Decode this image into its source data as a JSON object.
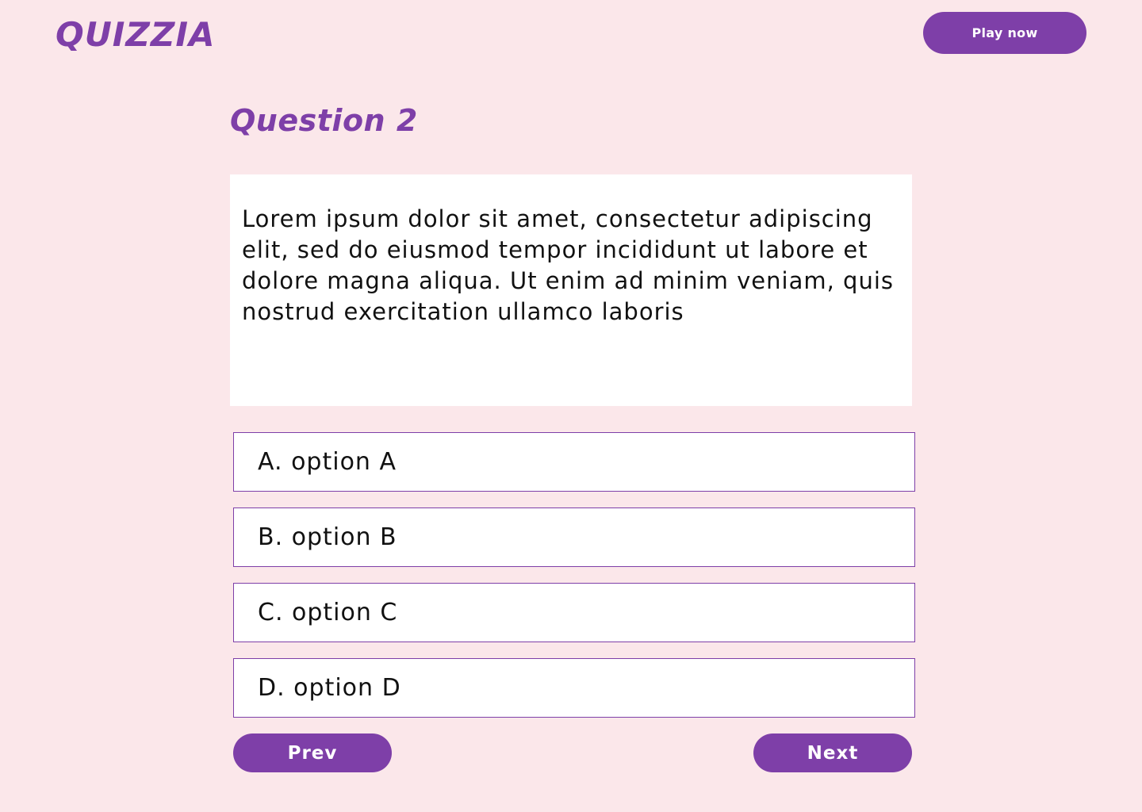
{
  "header": {
    "logo": "QUIZZIA",
    "play_label": "Play now"
  },
  "question": {
    "title": "Question 2",
    "text": "Lorem ipsum dolor sit amet, consectetur adipiscing elit, sed do eiusmod tempor incididunt ut labore et dolore magna aliqua. Ut enim ad minim veniam, quis nostrud exercitation ullamco laboris"
  },
  "options": [
    "A. option A",
    "B. option B",
    "C. option C",
    "D. option D"
  ],
  "nav": {
    "prev_label": "Prev",
    "next_label": "Next"
  },
  "colors": {
    "accent": "#7e3fa8",
    "background": "#fbe7ea",
    "panel": "#ffffff"
  }
}
